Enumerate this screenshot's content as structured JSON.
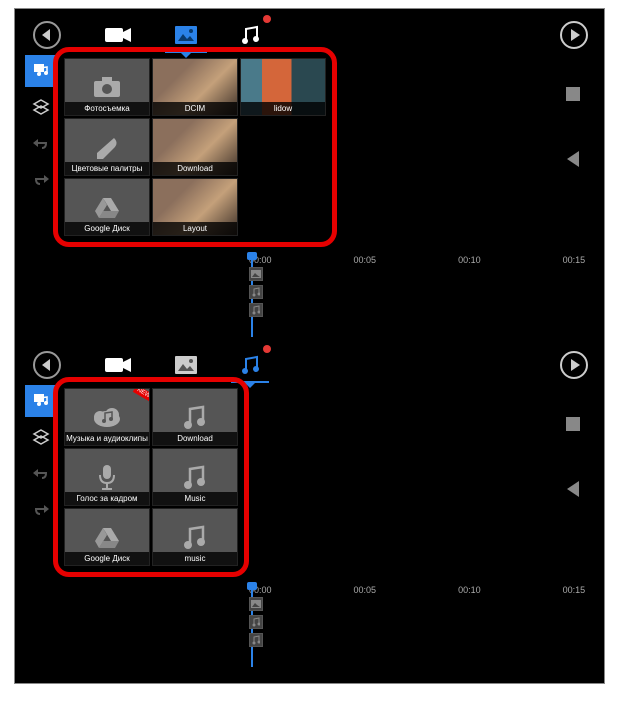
{
  "toolbar": {
    "tabs": [
      "video",
      "image",
      "music"
    ]
  },
  "panel1": {
    "active_tab": "image",
    "tiles": [
      {
        "label": "Фотосъемка",
        "icon": "camera"
      },
      {
        "label": "DCIM",
        "thumb": "photo1"
      },
      {
        "label": "lidow",
        "thumb": "photo2"
      },
      {
        "label": "Цветовые палитры",
        "icon": "palette"
      },
      {
        "label": "Download",
        "thumb": "photo1"
      },
      {
        "label": "Google Диск",
        "icon": "drive"
      },
      {
        "label": "Layout",
        "thumb": "photo1"
      }
    ]
  },
  "panel2": {
    "active_tab": "music",
    "tiles": [
      {
        "label": "Музыка и аудиоклипы",
        "icon": "cloud-music",
        "badge": "NEW"
      },
      {
        "label": "Download",
        "icon": "music-note"
      },
      {
        "label": "Голос за кадром",
        "icon": "mic"
      },
      {
        "label": "Music",
        "icon": "music-note"
      },
      {
        "label": "Google Диск",
        "icon": "drive"
      },
      {
        "label": "music",
        "icon": "music-note"
      }
    ]
  },
  "timeline": {
    "marks": [
      "00:00",
      "00:05",
      "00:10",
      "00:15"
    ]
  }
}
